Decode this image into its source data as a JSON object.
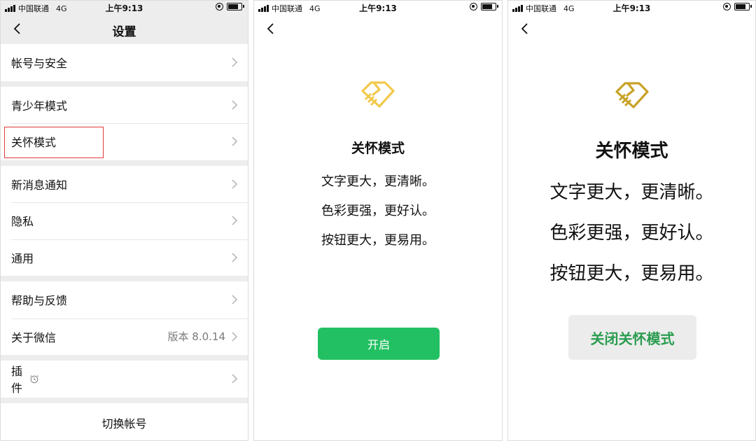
{
  "status_bar": {
    "carrier": "中国联通",
    "network": "4G",
    "time": "上午9:13"
  },
  "settings_screen": {
    "title": "设置",
    "groups": [
      [
        {
          "label": "帐号与安全"
        }
      ],
      [
        {
          "label": "青少年模式"
        },
        {
          "label": "关怀模式"
        }
      ],
      [
        {
          "label": "新消息通知"
        },
        {
          "label": "隐私"
        },
        {
          "label": "通用"
        }
      ],
      [
        {
          "label": "帮助与反馈"
        },
        {
          "label": "关于微信",
          "extra": "版本 8.0.14"
        }
      ],
      [
        {
          "label": "插件"
        }
      ]
    ],
    "switch_account": "切换帐号",
    "highlight_color": "#e23b3b"
  },
  "care_intro_screen": {
    "title": "关怀模式",
    "lines": [
      "文字更大，更清晰。",
      "色彩更强，更好认。",
      "按钮更大，更易用。"
    ],
    "button": "开启",
    "button_color": "#22c062",
    "logo_color": "#f2c94c"
  },
  "care_active_screen": {
    "title": "关怀模式",
    "lines": [
      "文字更大，更清晰。",
      "色彩更强，更好认。",
      "按钮更大，更易用。"
    ],
    "button": "关闭关怀模式",
    "button_text_color": "#2a9c4f",
    "logo_color": "#c9a227"
  },
  "icons": {
    "back": "chevron-left-icon",
    "row_arrow": "chevron-right-icon",
    "plugin": "plugin-clock-icon",
    "care_logo": "care-heart-hand-icon"
  }
}
